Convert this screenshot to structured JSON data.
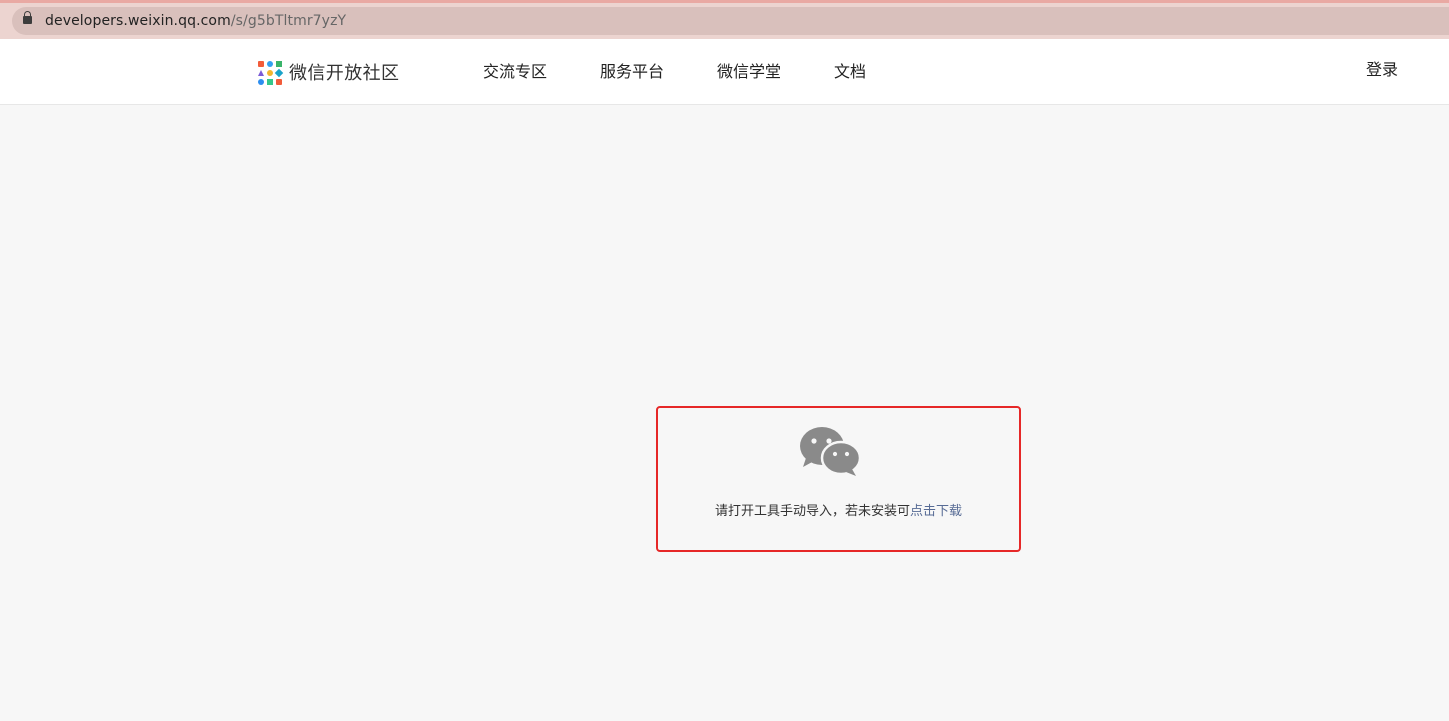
{
  "browser": {
    "url_host": "developers.weixin.qq.com",
    "url_path": "/s/g5bTltmr7yzY"
  },
  "header": {
    "site_title": "微信开放社区",
    "nav_items": [
      "交流专区",
      "服务平台",
      "微信学堂",
      "文档"
    ],
    "login_label": "登录"
  },
  "notice": {
    "message": "请打开工具手动导入，若未安装可",
    "download_link": "点击下载"
  },
  "colors": {
    "highlight_border": "#e62828",
    "link": "#576b95",
    "icon_gray": "#8a8a8a"
  },
  "icons": {
    "wechat": "wechat-icon",
    "lock": "lock-icon",
    "logo": "logo-icon"
  }
}
